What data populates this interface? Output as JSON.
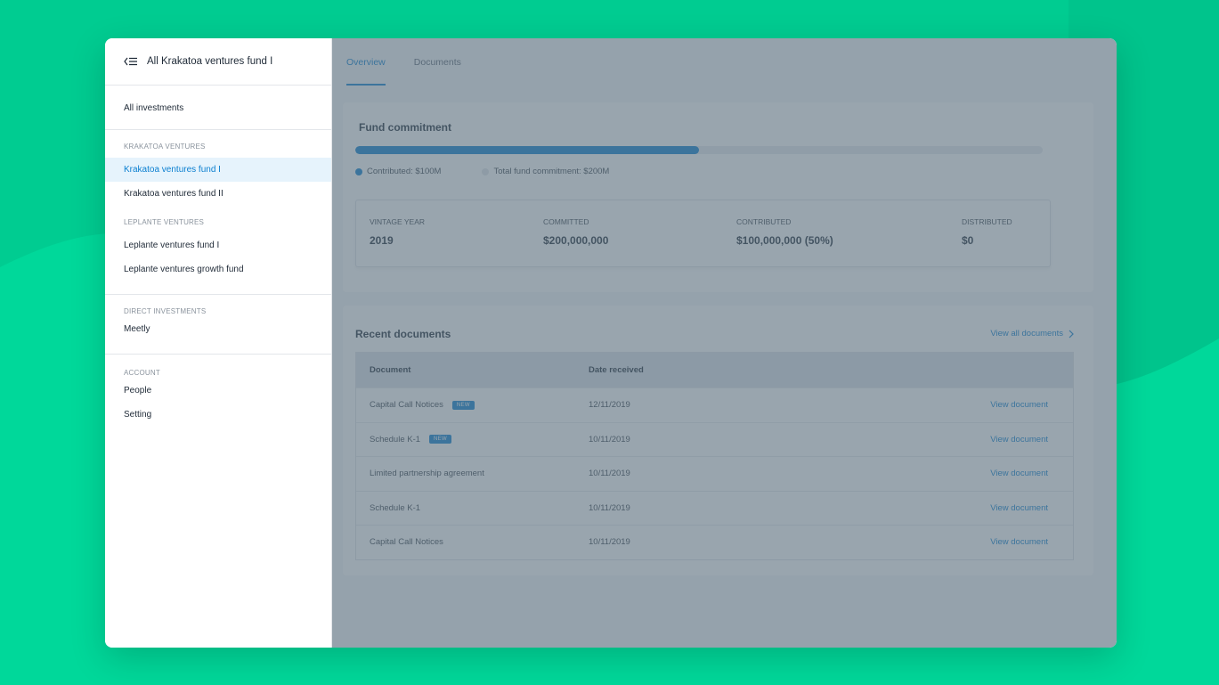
{
  "sidebar": {
    "title": "All Krakatoa ventures fund I",
    "all_investments": "All investments",
    "groups": [
      {
        "label": "KRAKATOA VENTURES",
        "items": [
          "Krakatoa ventures fund I",
          "Krakatoa ventures fund II"
        ]
      },
      {
        "label": "LEPLANTE VENTURES",
        "items": [
          "Leplante ventures fund I",
          "Leplante ventures growth fund"
        ]
      },
      {
        "label": "DIRECT INVESTMENTS",
        "items": [
          "Meetly"
        ]
      },
      {
        "label": "ACCOUNT",
        "items": [
          "People",
          "Setting"
        ]
      }
    ]
  },
  "tabs": [
    "Overview",
    "Documents"
  ],
  "commitment": {
    "title": "Fund commitment",
    "progress_fraction": 0.5,
    "contributed_legend": "Contributed: $100M",
    "total_legend": "Total fund commitment: $200M",
    "stats": [
      {
        "label": "VINTAGE YEAR",
        "value": "2019"
      },
      {
        "label": "COMMITTED",
        "value": "$200,000,000"
      },
      {
        "label": "CONTRIBUTED",
        "value": "$100,000,000 (50%)"
      },
      {
        "label": "DISTRIBUTED",
        "value": "$0"
      }
    ]
  },
  "documents": {
    "title": "Recent documents",
    "view_all": "View all documents",
    "headers": [
      "Document",
      "Date received"
    ],
    "rows": [
      {
        "name": "Capital Call Notices",
        "badge": "NEW",
        "date": "12/11/2019",
        "action": "View document"
      },
      {
        "name": "Schedule K-1",
        "badge": "NEW",
        "date": "10/11/2019",
        "action": "View document"
      },
      {
        "name": "Limited partnership agreement",
        "badge": "",
        "date": "10/11/2019",
        "action": "View document"
      },
      {
        "name": "Schedule K-1",
        "badge": "",
        "date": "10/11/2019",
        "action": "View document"
      },
      {
        "name": "Capital Call Notices",
        "badge": "",
        "date": "10/11/2019",
        "action": "View document"
      }
    ]
  },
  "colors": {
    "background": "#00d89a",
    "accent": "#0b7fd0",
    "active_bg": "#e6f3fc"
  }
}
